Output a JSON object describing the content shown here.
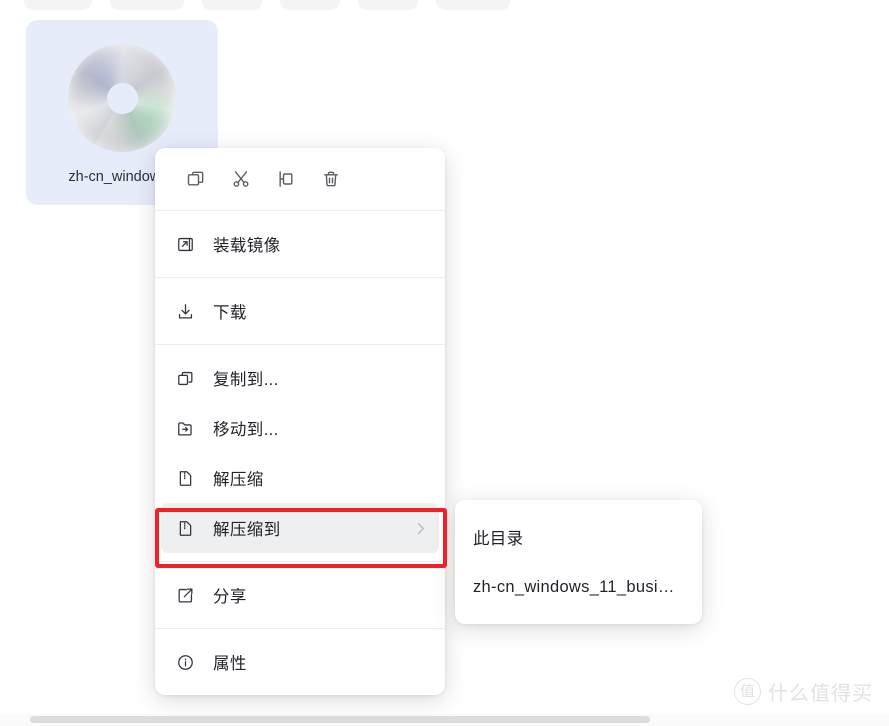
{
  "toolbar": {
    "pills": [
      "",
      "",
      "",
      "",
      "",
      ""
    ]
  },
  "file_card": {
    "name": "zh-cn_windows_",
    "icon": "disc-image-icon",
    "selected_bg": "#e7ecfb",
    "selected": true
  },
  "context_menu": {
    "quick_actions": [
      {
        "name": "copy-icon",
        "label": "复制"
      },
      {
        "name": "cut-icon",
        "label": "剪切"
      },
      {
        "name": "paste-icon",
        "label": "粘贴"
      },
      {
        "name": "delete-icon",
        "label": "删除"
      }
    ],
    "groups": [
      {
        "items": [
          {
            "icon": "mount-image-icon",
            "label": "装载镜像",
            "has_submenu": false,
            "highlighted": false
          }
        ]
      },
      {
        "items": [
          {
            "icon": "download-icon",
            "label": "下载",
            "has_submenu": false,
            "highlighted": false
          }
        ]
      },
      {
        "items": [
          {
            "icon": "copy-to-icon",
            "label": "复制到...",
            "has_submenu": false,
            "highlighted": false
          },
          {
            "icon": "move-to-icon",
            "label": "移动到...",
            "has_submenu": false,
            "highlighted": false
          },
          {
            "icon": "unzip-icon",
            "label": "解压缩",
            "has_submenu": false,
            "highlighted": false
          },
          {
            "icon": "unzip-to-icon",
            "label": "解压缩到",
            "has_submenu": true,
            "highlighted": true
          }
        ]
      },
      {
        "items": [
          {
            "icon": "share-icon",
            "label": "分享",
            "has_submenu": false,
            "highlighted": false
          }
        ]
      },
      {
        "items": [
          {
            "icon": "info-icon",
            "label": "属性",
            "has_submenu": false,
            "highlighted": false
          }
        ]
      }
    ]
  },
  "submenu": {
    "items": [
      {
        "label": "此目录"
      },
      {
        "label": "zh-cn_windows_11_busi…"
      }
    ]
  },
  "annotation": {
    "color": "#ef2127",
    "target": "解压缩到"
  },
  "watermark": {
    "logo_char": "值",
    "text": "什么值得买"
  }
}
